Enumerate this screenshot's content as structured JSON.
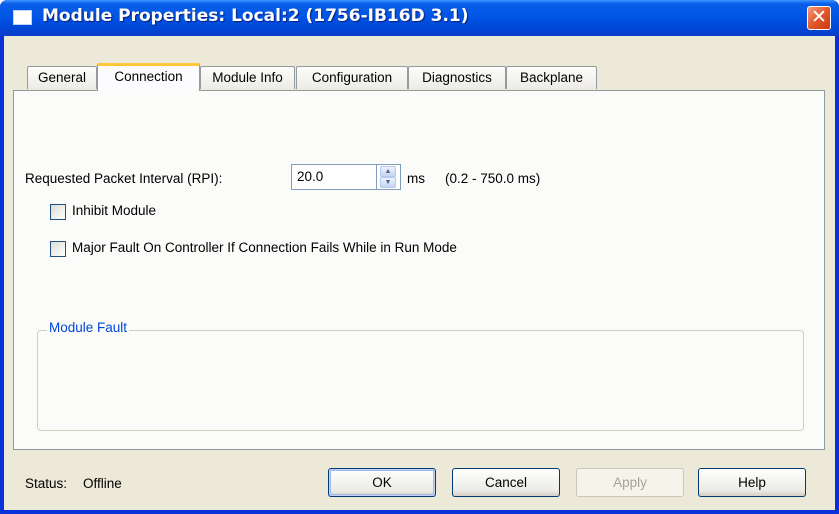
{
  "window": {
    "title": "Module Properties: Local:2 (1756-IB16D 3.1)",
    "close_glyph": "✕"
  },
  "tabs": [
    {
      "label": "General",
      "active": false
    },
    {
      "label": "Connection",
      "active": true
    },
    {
      "label": "Module Info",
      "active": false
    },
    {
      "label": "Configuration",
      "active": false
    },
    {
      "label": "Diagnostics",
      "active": false
    },
    {
      "label": "Backplane",
      "active": false
    }
  ],
  "connection": {
    "rpi_label": "Requested Packet Interval (RPI):",
    "rpi_value": "20.0",
    "rpi_unit": "ms",
    "rpi_range": "(0.2 - 750.0 ms)",
    "inhibit_label": "Inhibit Module",
    "inhibit_checked": false,
    "major_fault_label": "Major Fault On Controller If Connection Fails While in Run Mode",
    "major_fault_checked": false,
    "module_fault_legend": "Module Fault"
  },
  "footer": {
    "status_label": "Status:",
    "status_value": "Offline",
    "ok_label": "OK",
    "cancel_label": "Cancel",
    "apply_label": "Apply",
    "apply_enabled": false,
    "help_label": "Help"
  },
  "colors": {
    "titlebar": "#0055e5",
    "dialog_face": "#ece9d8",
    "active_tab_accent": "#ffc83c",
    "group_legend": "#0046d5"
  }
}
